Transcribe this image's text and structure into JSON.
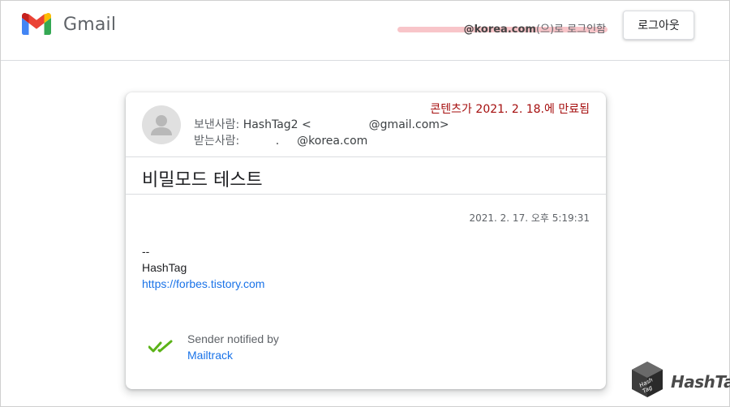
{
  "header": {
    "brand": "Gmail",
    "login_domain": "@korea.com",
    "login_suffix": "(으)로 로그인함",
    "logout_label": "로그아웃"
  },
  "message": {
    "expire_prefix": "콘텐츠가 ",
    "expire_date": "2021. 2. 18.",
    "expire_suffix": "에 만료됨",
    "from_label": "보낸사람:",
    "from_name": "HashTag2 <",
    "from_email": "@gmail.com>",
    "to_label": "받는사람:",
    "to_mark": ".",
    "to_email": "@korea.com",
    "subject": "비밀모드 테스트",
    "timestamp": "2021. 2. 17. 오후 5:19:31",
    "signature_dash": "--",
    "signature_name": "HashTag",
    "signature_link": "https://forbes.tistory.com",
    "tracker_text": "Sender notified by",
    "tracker_link": "Mailtrack"
  },
  "watermark": {
    "text": "HashTag"
  },
  "colors": {
    "gmail_red": "#EA4335",
    "gmail_blue": "#4285F4",
    "gmail_green": "#34A853",
    "gmail_yellow": "#FBBC04",
    "expire_red": "#A50E0E",
    "link_blue": "#1A73E8",
    "check_green": "#5BB318"
  },
  "icons": {
    "logo": "gmail-logo-icon",
    "avatar": "default-avatar-icon",
    "tracker": "double-check-icon",
    "watermark": "hashtag-cube-icon"
  }
}
